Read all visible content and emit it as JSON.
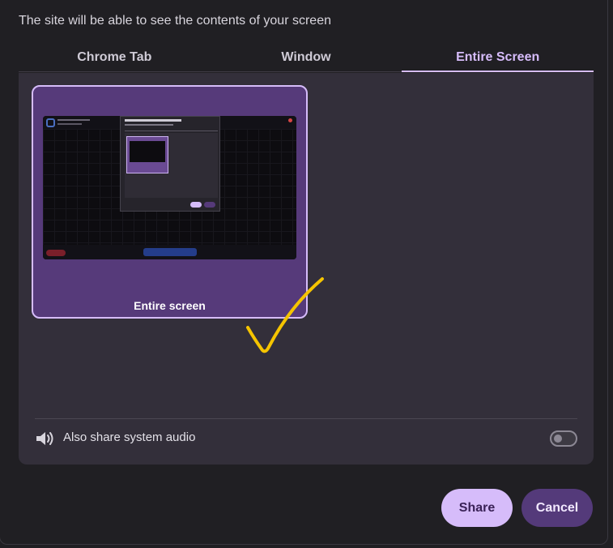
{
  "dialog": {
    "subtitle": "The site will be able to see the contents of your screen"
  },
  "tabs": [
    {
      "label": "Chrome Tab",
      "active": false
    },
    {
      "label": "Window",
      "active": false
    },
    {
      "label": "Entire Screen",
      "active": true
    }
  ],
  "sources": [
    {
      "label": "Entire screen",
      "selected": true
    }
  ],
  "audio": {
    "label": "Also share system audio",
    "enabled": false,
    "icon": "speaker-icon"
  },
  "buttons": {
    "share_label": "Share",
    "cancel_label": "Cancel"
  },
  "colors": {
    "accent": "#d6bcfa",
    "card_bg": "#563a7a",
    "annotation": "#f5c400"
  }
}
